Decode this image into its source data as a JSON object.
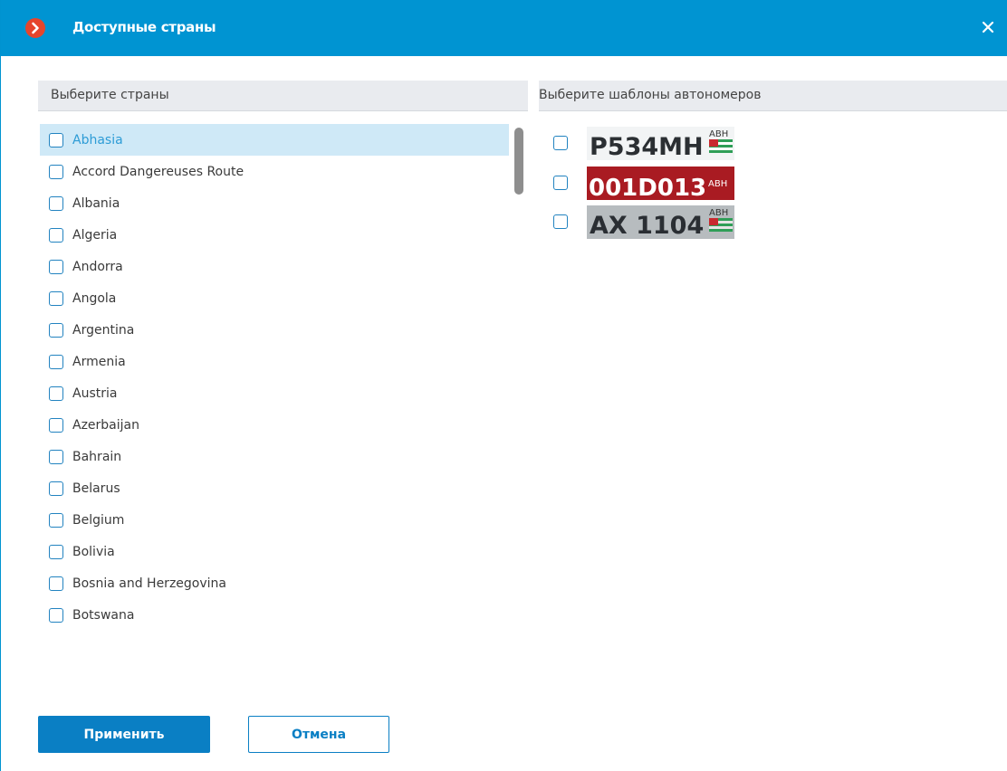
{
  "window": {
    "title": "Доступные страны",
    "logo_icon": "app-logo-icon",
    "close_icon": "close-icon"
  },
  "left_panel": {
    "header": "Выберите страны",
    "countries": [
      {
        "label": "Abhasia",
        "checked": false,
        "selected": true
      },
      {
        "label": "Accord Dangereuses Route",
        "checked": false
      },
      {
        "label": "Albania",
        "checked": false
      },
      {
        "label": "Algeria",
        "checked": false
      },
      {
        "label": "Andorra",
        "checked": false
      },
      {
        "label": "Angola",
        "checked": false
      },
      {
        "label": "Argentina",
        "checked": false
      },
      {
        "label": "Armenia",
        "checked": false
      },
      {
        "label": "Austria",
        "checked": false
      },
      {
        "label": "Azerbaijan",
        "checked": false
      },
      {
        "label": "Bahrain",
        "checked": false
      },
      {
        "label": "Belarus",
        "checked": false
      },
      {
        "label": "Belgium",
        "checked": false
      },
      {
        "label": "Bolivia",
        "checked": false
      },
      {
        "label": "Bosnia and Herzegovina",
        "checked": false
      },
      {
        "label": "Botswana",
        "checked": false
      }
    ]
  },
  "right_panel": {
    "header": "Выберите шаблоны автономеров",
    "plates": [
      {
        "number": "P534MH",
        "region": "ABH",
        "checked": false
      },
      {
        "number": "001D013",
        "region": "ABH",
        "checked": false
      },
      {
        "number": "AX 1104",
        "region": "ABH",
        "checked": false
      }
    ]
  },
  "footer": {
    "apply_label": "Применить",
    "cancel_label": "Отмена"
  },
  "colors": {
    "titlebar": "#0094d2",
    "accent": "#0a7fc4",
    "selected_row": "#cfe9f7",
    "plate_red": "#a91b22"
  }
}
